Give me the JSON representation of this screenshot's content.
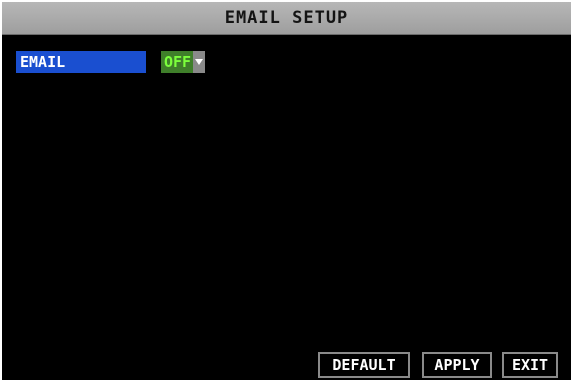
{
  "window": {
    "title": "EMAIL SETUP"
  },
  "email": {
    "label": "EMAIL",
    "value": "OFF"
  },
  "buttons": {
    "default_label": "DEFAULT",
    "apply_label": "APPLY",
    "exit_label": "EXIT"
  },
  "colors": {
    "titlebar": "#a8a8a8",
    "label_highlight": "#1a4fd0",
    "select_bg": "#3f7f2a",
    "select_text": "#7cff3c",
    "background": "#000000"
  },
  "icons": {
    "dropdown": "chevron-down-icon"
  }
}
